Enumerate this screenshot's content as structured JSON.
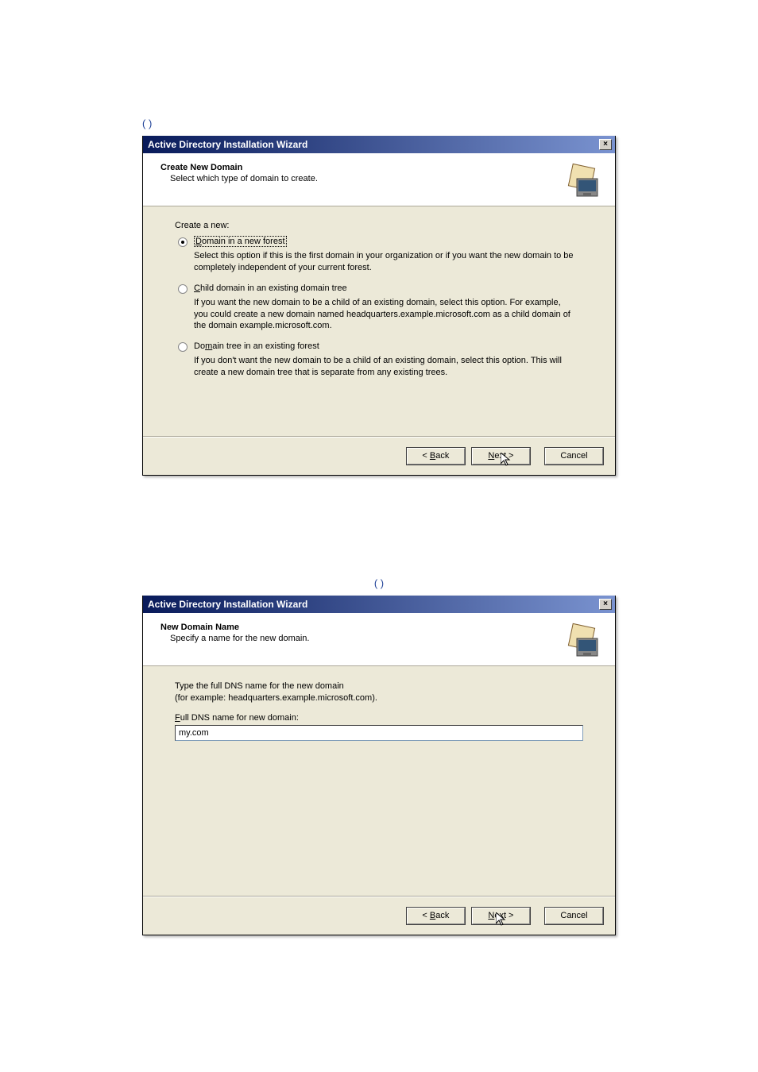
{
  "caption1": "(          )",
  "caption2": "(          )",
  "dialog1": {
    "title": "Active Directory Installation Wizard",
    "close": "×",
    "heading": "Create New Domain",
    "subheading": "Select which type of domain to create.",
    "lead": "Create a new:",
    "opt1": {
      "label_pre": "D",
      "label_rest": "omain in a new forest",
      "explain": "Select this option if this is the first domain in your organization or if you want the new domain to be completely independent of your current forest."
    },
    "opt2": {
      "label_pre": "C",
      "label_rest": "hild domain in an existing domain tree",
      "explain": "If you want the new domain to be a child of an existing domain, select this option. For example, you could create a new domain named headquarters.example.microsoft.com as a child domain of the domain example.microsoft.com."
    },
    "opt3": {
      "label_pre": "m",
      "label_prefix": "Do",
      "label_rest": "ain tree in an existing forest",
      "explain": "If you don't want the new domain to be a child of an existing domain, select this option. This will create a new domain tree that is separate from any existing trees."
    },
    "buttons": {
      "back": "< Back",
      "next": "Next >",
      "cancel": "Cancel",
      "back_u": "B",
      "next_u": "N"
    }
  },
  "dialog2": {
    "title": "Active Directory Installation Wizard",
    "close": "×",
    "heading": "New Domain Name",
    "subheading": "Specify a name for the new domain.",
    "intro": "Type the full DNS name for the new domain\n(for example: headquarters.example.microsoft.com).",
    "field_label_pre": "F",
    "field_label_rest": "ull DNS name for new domain:",
    "field_value": "my.com",
    "buttons": {
      "back": "< Back",
      "next": "Next >",
      "cancel": "Cancel",
      "back_u": "B",
      "next_u": "N"
    }
  }
}
